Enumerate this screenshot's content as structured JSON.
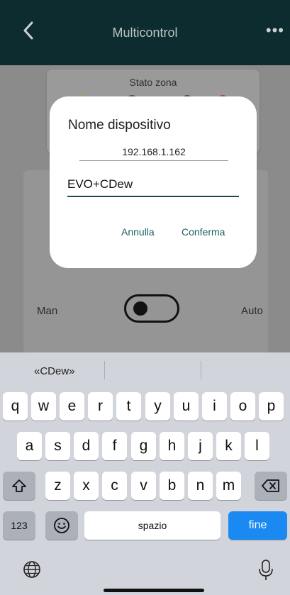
{
  "header": {
    "title": "Multicontrol",
    "back_icon": "chevron-left-icon",
    "more_icon": "ellipsis-icon"
  },
  "background": {
    "zone_card_label": "Stato zona",
    "mode_left": "Man",
    "mode_right": "Auto"
  },
  "dialog": {
    "title": "Nome dispositivo",
    "ip": "192.168.1.162",
    "name_value": "EVO+CDew",
    "cancel_label": "Annulla",
    "confirm_label": "Conferma"
  },
  "keyboard": {
    "suggestion": "«CDew»",
    "row1": [
      "q",
      "w",
      "e",
      "r",
      "t",
      "y",
      "u",
      "i",
      "o",
      "p"
    ],
    "row2": [
      "a",
      "s",
      "d",
      "f",
      "g",
      "h",
      "j",
      "k",
      "l"
    ],
    "row3": [
      "z",
      "x",
      "c",
      "v",
      "b",
      "n",
      "m"
    ],
    "numbers_label": "123",
    "space_label": "spazio",
    "done_label": "fine"
  },
  "colors": {
    "header_bg": "#0d2c2f",
    "accent": "#1d5d63",
    "keyboard_done": "#1a8af2"
  }
}
